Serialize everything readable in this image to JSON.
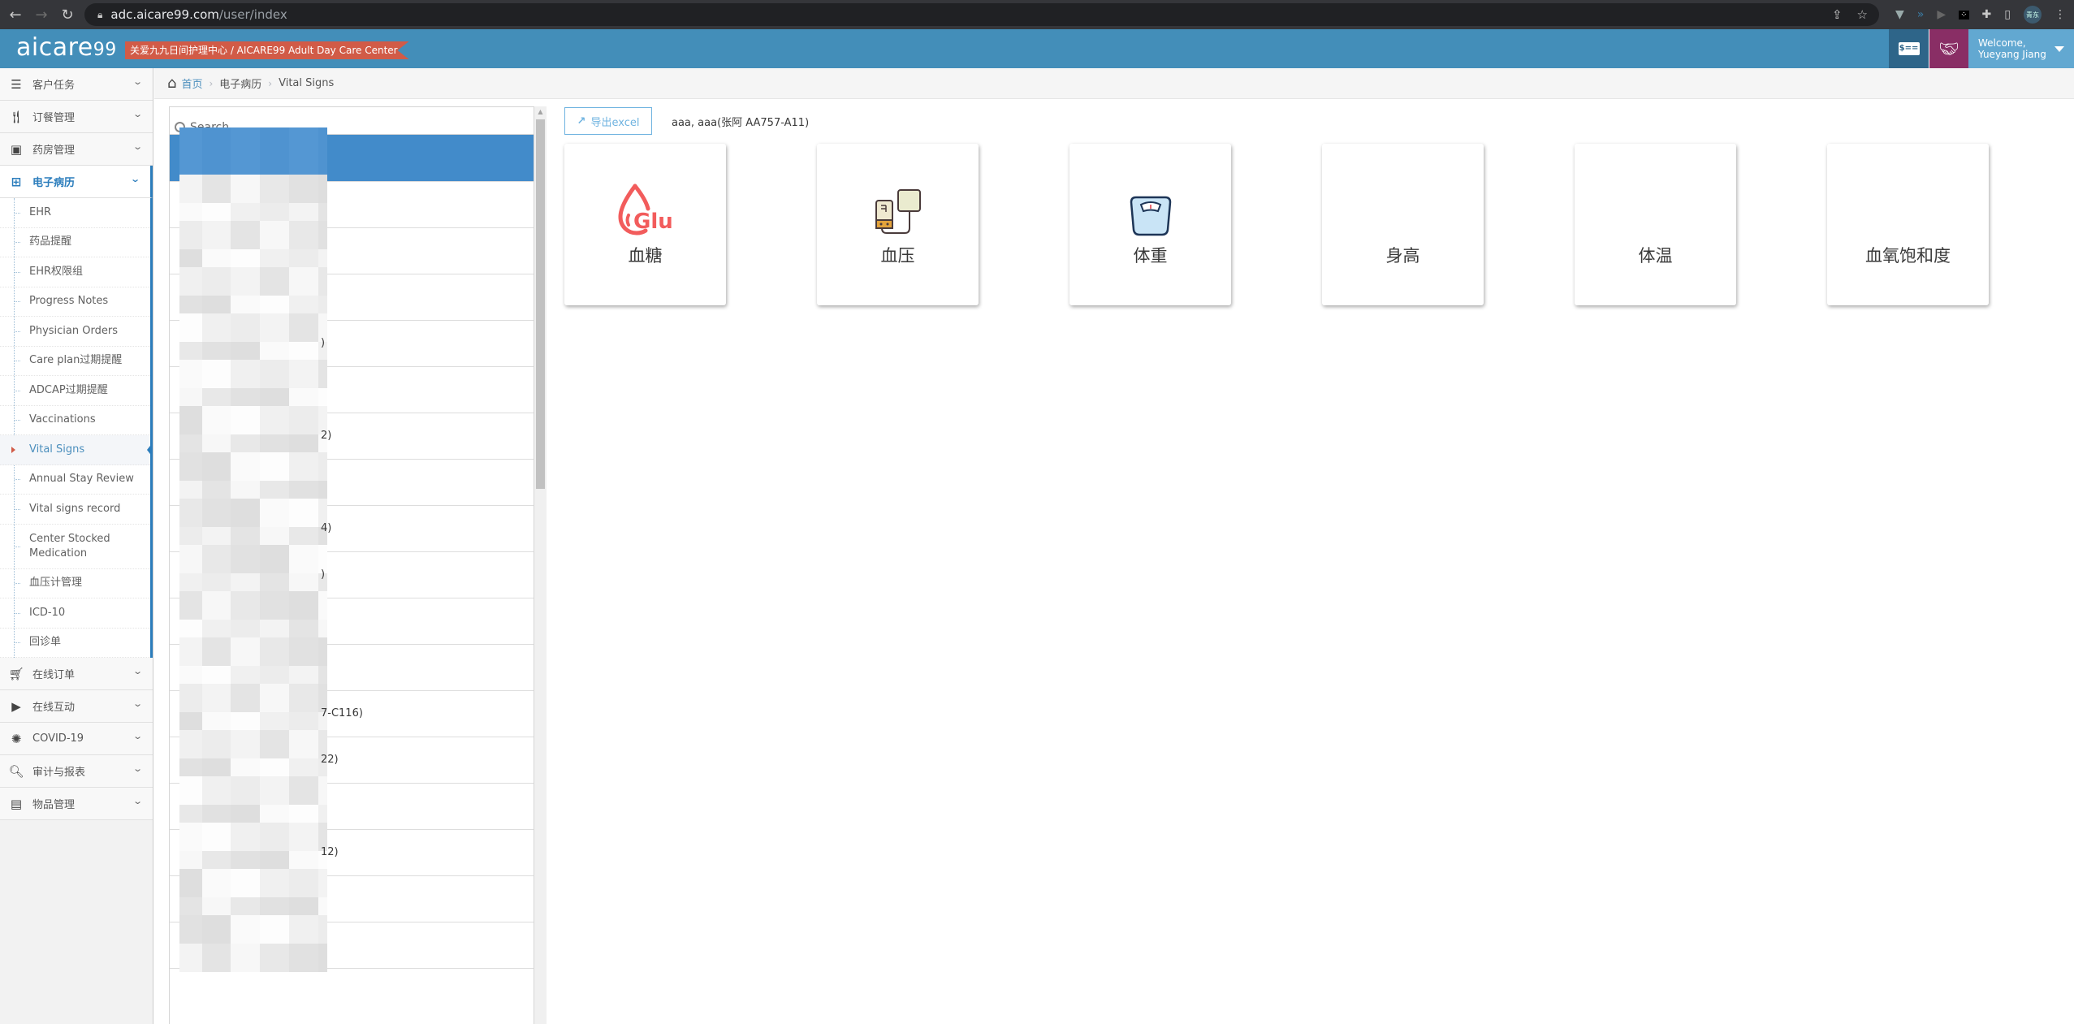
{
  "browser": {
    "url_host": "adc.aicare99.com",
    "url_path": "/user/index",
    "profile_initials": "青东"
  },
  "header": {
    "logo_text": "aicare",
    "logo_suffix": "99",
    "center_name": "关爱九九日间护理中心 / AICARE99 Adult Day Care Center",
    "welcome": "Welcome,",
    "user_name": "Yueyang Jiang",
    "billing_icon_text": "$==",
    "colors": {
      "header_bg": "#438eb9",
      "badge_bg": "#d15b47",
      "billing_bg": "#2e6589",
      "partner_bg": "#892e65",
      "user_bg": "#62a8d1"
    }
  },
  "sidebar": {
    "groups_top": [
      {
        "label": "客户任务",
        "icon": "tasks-icon"
      },
      {
        "label": "订餐管理",
        "icon": "cutlery-icon"
      },
      {
        "label": "药房管理",
        "icon": "pharmacy-icon"
      }
    ],
    "active_group": {
      "label": "电子病历",
      "icon": "laptop-medical-icon"
    },
    "submenu": [
      {
        "label": "EHR"
      },
      {
        "label": "药品提醒"
      },
      {
        "label": "EHR权限组"
      },
      {
        "label": "Progress Notes"
      },
      {
        "label": "Physician Orders"
      },
      {
        "label": "Care plan过期提醒"
      },
      {
        "label": "ADCAP过期提醒"
      },
      {
        "label": "Vaccinations"
      },
      {
        "label": "Vital Signs",
        "active": true
      },
      {
        "label": "Annual Stay Review"
      },
      {
        "label": "Vital signs record"
      },
      {
        "label": "Center Stocked Medication"
      },
      {
        "label": "血压计管理"
      },
      {
        "label": "ICD-10"
      },
      {
        "label": "回诊单"
      }
    ],
    "groups_bottom": [
      {
        "label": "在线订单",
        "icon": "shopping-cart-icon"
      },
      {
        "label": "在线互动",
        "icon": "video-icon"
      },
      {
        "label": "COVID-19",
        "icon": "lungs-virus-icon"
      },
      {
        "label": "审计与报表",
        "icon": "search-dollar-icon"
      },
      {
        "label": "物品管理",
        "icon": "box-open-icon"
      }
    ]
  },
  "breadcrumb": {
    "home": "首页",
    "section": "电子病历",
    "current": "Vital Signs"
  },
  "patient_list": {
    "search_placeholder": "Search",
    "rows": [
      {
        "visible_tail": "",
        "selected": true
      },
      {
        "visible_tail": ""
      },
      {
        "visible_tail": ""
      },
      {
        "visible_tail": ""
      },
      {
        "visible_tail": ")"
      },
      {
        "visible_tail": ""
      },
      {
        "visible_tail": "2)"
      },
      {
        "visible_tail": ""
      },
      {
        "visible_tail": "4)"
      },
      {
        "visible_tail": ")"
      },
      {
        "visible_tail": ""
      },
      {
        "visible_tail": ""
      },
      {
        "visible_tail": "7-C116)"
      },
      {
        "visible_tail": "22)"
      },
      {
        "visible_tail": ""
      },
      {
        "visible_tail": "12)"
      },
      {
        "visible_tail": ""
      },
      {
        "visible_tail": ""
      }
    ]
  },
  "main": {
    "export_label": "导出excel",
    "patient_name": "aaa, aaa(张阿 AA757-A11)",
    "cards": [
      {
        "label": "血糖",
        "icon": "glucose-drop-icon",
        "icon_text": "Glu"
      },
      {
        "label": "血压",
        "icon": "blood-pressure-monitor-icon"
      },
      {
        "label": "体重",
        "icon": "weight-scale-icon"
      },
      {
        "label": "身高",
        "icon": null
      },
      {
        "label": "体温",
        "icon": null
      },
      {
        "label": "血氧饱和度",
        "icon": null
      }
    ]
  }
}
